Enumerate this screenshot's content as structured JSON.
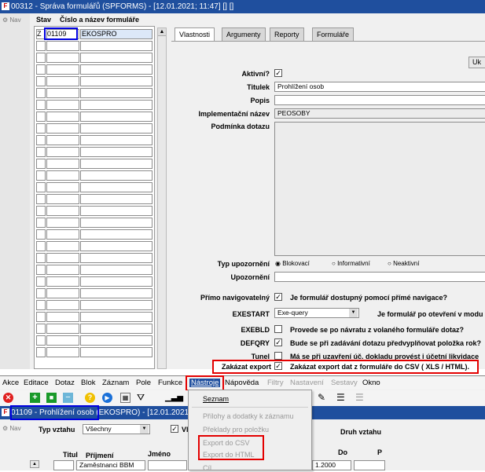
{
  "window1": {
    "title": "00312 - Správa formulářů (SPFORMS) - [12.01.2021; 11:47] [] []",
    "nav": "Nav",
    "grid": {
      "col_stav": "Stav",
      "col_name": "Číslo a název formuláře",
      "first_row": {
        "stav": "Z",
        "number": "01109",
        "name": "EKOSPRO"
      }
    },
    "tabs": [
      "Vlastnosti",
      "Argumenty",
      "Reporty",
      "Formuláře"
    ],
    "button_uk": "Uk",
    "form": {
      "aktivni_label": "Aktivní?",
      "titulek_label": "Titulek",
      "titulek_value": "Prohlížení osob",
      "popis_label": "Popis",
      "impl_label": "Implementační název",
      "impl_value": "PEOSOBY",
      "podminka_label": "Podmínka dotazu",
      "typ_label": "Typ upozornění",
      "typ_options": [
        "Blokovací",
        "Informativní",
        "Neaktivní"
      ],
      "upozorneni_label": "Upozornění",
      "primo_label": "Přímo navigovatelný",
      "primo_text": "Je formulář dostupný pomocí přímé navigace?",
      "exestart_label": "EXESTART",
      "exestart_value": "Exe-query",
      "exestart_text": "Je formulář po otevření v modu",
      "exebld_label": "EXEBLD",
      "exebld_text": "Provede se po návratu z volaného formuláře dotaz?",
      "defqry_label": "DEFQRY",
      "defqry_text": "Bude se při zadávání dotazu předvyplňovat položka rok?",
      "tunel_label": "Tunel",
      "tunel_text": "Má se při uzavření úč. dokladu provést i účetní likvidace",
      "zakazat_label": "Zakázat export",
      "zakazat_text": "Zakázat export dat z formuláře do CSV ( XLS / HTML)."
    }
  },
  "window2": {
    "menu": [
      "Akce",
      "Editace",
      "Dotaz",
      "Blok",
      "Záznam",
      "Pole",
      "Funkce",
      "Nástroje",
      "Nápověda",
      "Filtry",
      "Nastavení",
      "Sestavy",
      "Okno"
    ],
    "title": "01109 - Prohlížení osob",
    "title_rest": "(EKOSPRO) - [12.01.2021;",
    "nav": "Nav",
    "typ_vztahu_label": "Typ vztahu",
    "typ_vztahu_value": "Všechny",
    "vl_label": "Vl",
    "druh_label": "Druh vztahu",
    "col_titul": "Titul",
    "col_prijmeni": "Příjmení",
    "col_jmeno": "Jméno",
    "col_do": "Do",
    "col_p": "P",
    "row1_prijmeni": "Zaměstnanci BBM",
    "row1_date": "1.2000",
    "dropdown": [
      "Seznam",
      "Přílohy a dodatky k záznamu",
      "Překlady pro položku",
      "Export do CSV",
      "Export do HTML",
      "Cíl ..."
    ]
  },
  "colors": {
    "title_bar": "#1f4f9e",
    "highlight_red": "#e30000",
    "highlight_blue": "#0000e0"
  }
}
